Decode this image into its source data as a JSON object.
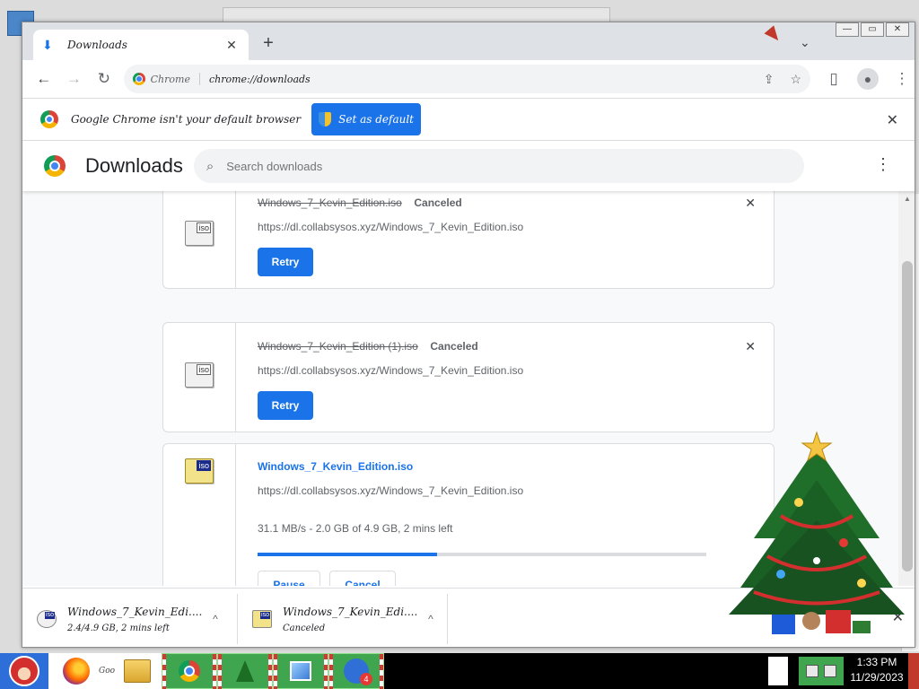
{
  "tab": {
    "title": "Downloads",
    "close": "✕",
    "new_tab": "+"
  },
  "toolbar": {
    "chip_label": "Chrome",
    "url": "chrome://downloads"
  },
  "infobar": {
    "message": "Google Chrome isn't your default browser",
    "button": "Set as default",
    "close": "✕"
  },
  "downloads_page": {
    "title": "Downloads",
    "search_placeholder": "Search downloads"
  },
  "items": [
    {
      "filename": "Windows_7_Kevin_Edition.iso",
      "status": "Canceled",
      "url": "https://dl.collabsysos.xyz/Windows_7_Kevin_Edition.iso",
      "action": "Retry",
      "icon_label": "iso"
    },
    {
      "filename": "Windows_7_Kevin_Edition (1).iso",
      "status": "Canceled",
      "url": "https://dl.collabsysos.xyz/Windows_7_Kevin_Edition.iso",
      "action": "Retry",
      "icon_label": "iso"
    },
    {
      "filename": "Windows_7_Kevin_Edition.iso",
      "url": "https://dl.collabsysos.xyz/Windows_7_Kevin_Edition.iso",
      "progress_text": "31.1 MB/s - 2.0 GB of 4.9 GB, 2 mins left",
      "progress_fraction": 0.4,
      "pause": "Pause",
      "cancel": "Cancel",
      "icon_label": "iso"
    }
  ],
  "shelf": {
    "items": [
      {
        "name": "Windows_7_Kevin_Edi....iso",
        "sub": "2.4/4.9 GB, 2 mins left",
        "chevron": "^"
      },
      {
        "name": "Windows_7_Kevin_Edi....iso",
        "sub": "Canceled",
        "chevron": "^"
      }
    ],
    "close": "✕"
  },
  "taskbar": {
    "quicklaunch_label": "Goo",
    "chat_badge": "4",
    "time": "1:33 PM",
    "date": "11/29/2023"
  },
  "colors": {
    "accent": "#1a73e8",
    "taskbar_green": "#3fa64f",
    "taskbar_bg": "#000000"
  },
  "icons": {
    "tab": "download-icon",
    "back": "arrow-left-icon",
    "forward": "arrow-right-icon",
    "reload": "reload-icon",
    "share": "share-icon",
    "bookmark": "star-icon",
    "sidepanel": "side-panel-icon",
    "profile": "person-icon",
    "menu": "kebab-menu-icon",
    "search": "search-icon"
  }
}
